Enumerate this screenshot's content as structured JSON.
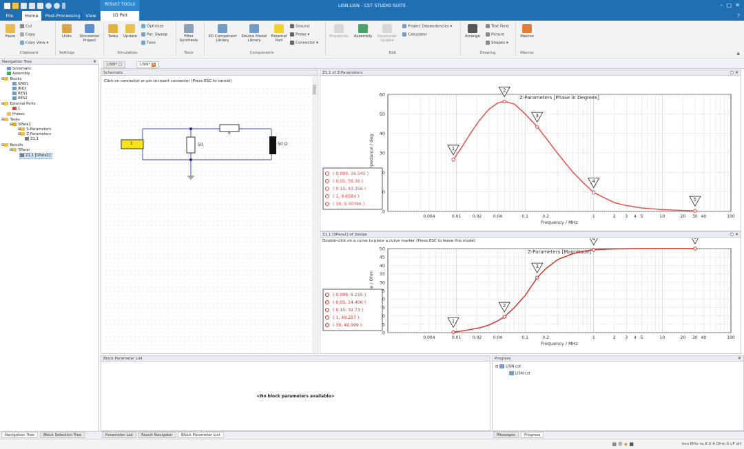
{
  "window_title": "LISN.LISN - CST STUDIO SUITE",
  "context_tab": {
    "group": "RESULT TOOLS",
    "sub": "1D Plot"
  },
  "tabs": [
    "File",
    "Home",
    "Post-Processing",
    "View"
  ],
  "ribbon": {
    "paste": "Paste",
    "cut": "Cut",
    "copy": "Copy",
    "copy_view": "Copy View",
    "units": "Units",
    "sim_project": "Simulation Project",
    "tasks": "Tasks",
    "update": "Update",
    "optimize": "Optimize",
    "par_sweep": "Par. Sweep",
    "tune": "Tune",
    "filter_synthesis": "Filter Synthesis",
    "comp3d_library": "3D Component Library",
    "device_model_library": "Device Model Library",
    "external_port": "External Port",
    "ground": "Ground",
    "probe": "Probe",
    "connector": "Connector",
    "properties": "Properties",
    "assembly": "Assembly",
    "param_update": "Parameter Update",
    "project_dependencies": "Project Dependencies",
    "calculator": "Calculator",
    "arrange": "Arrange",
    "text_field": "Text Field",
    "picture": "Picture",
    "shapes": "Shapes",
    "macros": "Macros",
    "groups": [
      "Clipboard",
      "Settings",
      "Simulation",
      "Tools",
      "Components",
      "Edit",
      "Drawing",
      "Macros"
    ]
  },
  "nav": {
    "title": "Navigation Tree",
    "items": [
      "Schematic",
      "Assembly",
      "Blocks",
      "GND1",
      "IND1",
      "RES1",
      "RES2",
      "External Ports",
      "1",
      "Probes",
      "Tasks",
      "SPara1",
      "S-Parameters",
      "Z-Parameters",
      "Z1,1",
      "Results",
      "SParai",
      "Z1,1 [SPara1]"
    ]
  },
  "doc_tabs": [
    "LISN*",
    "LISN*"
  ],
  "schematic": {
    "title": "Schematic",
    "hint": "Click on connector or pin to insert connector (Press ESC to cancel)",
    "r1_label": "5",
    "r2_label": "50",
    "port_label": "1",
    "load_label": "50 Ω"
  },
  "plot_top": {
    "header": "Z1,1 of Z-Parameters",
    "title": "Z-Parameters [Phase in Degrees]",
    "hint": "",
    "chart_data": {
      "type": "line",
      "title": "Z-Parameters [Phase in Degrees]",
      "xlabel": "Frequency / MHz",
      "ylabel": "Impedance / deg",
      "xscale": "log",
      "xlim": [
        0.001,
        100
      ],
      "ylim": [
        0,
        60
      ],
      "yticks": [
        0,
        10,
        20,
        30,
        40,
        50,
        60
      ],
      "xtick_labels": [
        "0.004",
        "0.01",
        "0.02",
        "0.04",
        "0.1",
        "0.2",
        "1",
        "2",
        "3",
        "4",
        "5",
        "10",
        "20",
        "30",
        "40",
        "100"
      ],
      "xtick_values": [
        0.004,
        0.01,
        0.02,
        0.04,
        0.1,
        0.2,
        1,
        2,
        3,
        4,
        5,
        10,
        20,
        30,
        40,
        100
      ],
      "series": [
        {
          "x": [
            0.009,
            0.012,
            0.016,
            0.022,
            0.03,
            0.04,
            0.05,
            0.07,
            0.1,
            0.15,
            0.2,
            0.3,
            0.5,
            0.7,
            1,
            2,
            3,
            5,
            10,
            20,
            30
          ],
          "y": [
            26.5,
            33,
            40,
            47,
            52.5,
            55.6,
            56.4,
            55,
            50,
            43.4,
            37.8,
            29.6,
            20,
            14.8,
            9.7,
            4.5,
            3,
            1.8,
            0.9,
            0.5,
            0.3
          ]
        }
      ],
      "markers": [
        {
          "id": "1",
          "x": 0.009,
          "y": 26.545
        },
        {
          "id": "2",
          "x": 0.05,
          "y": 56.36
        },
        {
          "id": "3",
          "x": 0.15,
          "y": 43.356
        },
        {
          "id": "4",
          "x": 1,
          "y": 9.6584
        },
        {
          "id": "5",
          "x": 30,
          "y": 0.30396
        }
      ],
      "marker_labels": [
        "( 0.009, 26.545 )",
        "( 0.05, 56.36 )",
        "( 0.15, 43.356 )",
        "( 1, 9.6584 )",
        "( 30, 0.30396 )"
      ],
      "line_color": "#e8453c"
    }
  },
  "plot_bottom": {
    "header": "Z1,1 [SPara1] of Design",
    "title": "Z-Parameters [Magnitude]",
    "hint": "Double-click on a curve to place a curve marker (Press ESC to leave this mode)",
    "chart_data": {
      "type": "line",
      "title": "Z-Parameters [Magnitude]",
      "xlabel": "Frequency / MHz",
      "ylabel": "Impedance / Ohm",
      "xscale": "log",
      "xlim": [
        0.001,
        100
      ],
      "ylim": [
        0,
        50
      ],
      "yticks": [
        0,
        5,
        10,
        15,
        20,
        25,
        30,
        35,
        40,
        45,
        50
      ],
      "xtick_labels": [
        "0.004",
        "0.01",
        "0.02",
        "0.04",
        "0.1",
        "0.2",
        "1",
        "2",
        "3",
        "4",
        "5",
        "10",
        "20",
        "30",
        "40",
        "100"
      ],
      "xtick_values": [
        0.004,
        0.01,
        0.02,
        0.04,
        0.1,
        0.2,
        1,
        2,
        3,
        4,
        5,
        10,
        20,
        30,
        40,
        100
      ],
      "series": [
        {
          "x": [
            0.009,
            0.012,
            0.016,
            0.022,
            0.03,
            0.04,
            0.05,
            0.07,
            0.1,
            0.15,
            0.2,
            0.3,
            0.5,
            0.7,
            1,
            2,
            5,
            10,
            30
          ],
          "y": [
            0.3,
            1,
            1.8,
            2.9,
            4.6,
            7,
            9.4,
            15,
            22,
            32.7,
            38,
            43.5,
            47,
            48.4,
            49.3,
            49.8,
            50,
            50,
            50
          ]
        }
      ],
      "markers": [
        {
          "id": "1",
          "x": 0.009,
          "y": 0.3
        },
        {
          "id": "2",
          "x": 0.05,
          "y": 9.406
        },
        {
          "id": "3",
          "x": 0.15,
          "y": 32.73
        },
        {
          "id": "4",
          "x": 1,
          "y": 49.257
        },
        {
          "id": "5",
          "x": 30,
          "y": 49.999
        }
      ],
      "marker_labels": [
        "( 0.009, 5.215 )",
        "( 0.05, 14.406 )",
        "( 0.15, 32.73 )",
        "( 1, 49.257 )",
        "( 30, 49.999 )"
      ],
      "line_color": "#d42a1e"
    }
  },
  "block_params": {
    "title": "Block Parameter List",
    "message": "<No block parameters available>"
  },
  "progress": {
    "title": "Progress",
    "root": "LISN.cst",
    "child": "LISN.cst"
  },
  "bottom_tabs_left": [
    "Navigation Tree",
    "Block Selection Tree"
  ],
  "bottom_tabs_mid": [
    "Parameter List",
    "Result Navigator",
    "Block Parameter List"
  ],
  "bottom_tabs_right": [
    "Messages",
    "Progress"
  ],
  "status": {
    "units": "mm  MHz  ns  K  V  A  Ohm  S  uF  uH"
  }
}
